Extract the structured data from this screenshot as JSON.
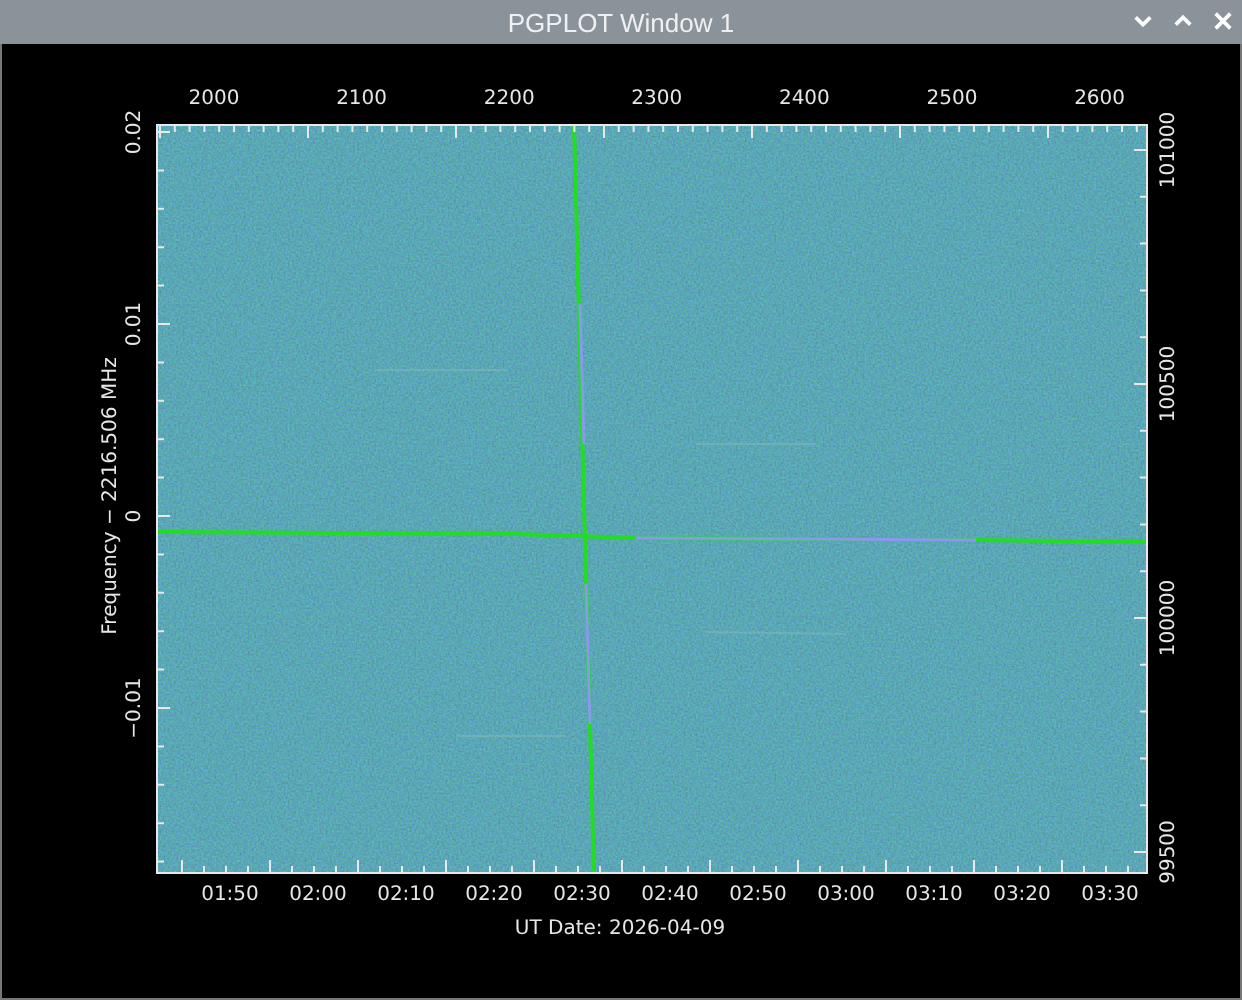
{
  "window": {
    "title": "PGPLOT Window 1"
  },
  "plot": {
    "top_axis_ticks": [
      "2000",
      "2100",
      "2200",
      "2300",
      "2400",
      "2500",
      "2600"
    ],
    "left_axis_ticks": [
      "0.02",
      "0.01",
      "0",
      "−0.01"
    ],
    "right_axis_ticks": [
      "101000",
      "100500",
      "100000",
      "99500"
    ],
    "bottom_axis_ticks": [
      "01:50",
      "02:00",
      "02:10",
      "02:20",
      "02:30",
      "02:40",
      "02:50",
      "03:00",
      "03:10",
      "03:20",
      "03:30"
    ],
    "ylabel": "Frequency − 2216.506 MHz",
    "xlabel": "UT Date: 2026-04-09"
  }
}
